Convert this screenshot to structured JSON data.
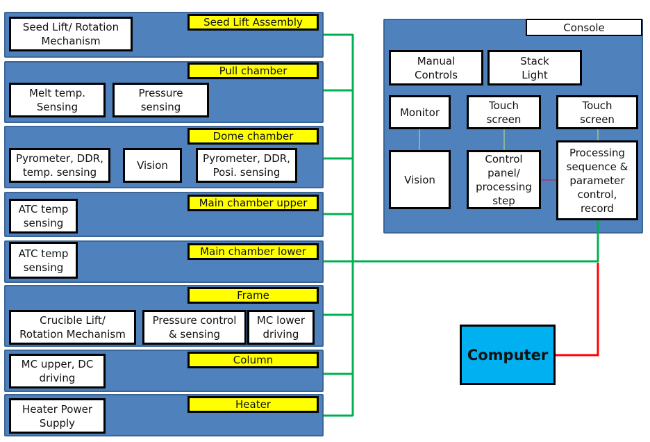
{
  "colors": {
    "panel": "#4F81BD",
    "label": "#FFFF00",
    "computer": "#00B0F0",
    "bus": "#00B050",
    "signal": "#FF0000",
    "thin_link": "#C4E86B"
  },
  "sections": [
    {
      "label": "Seed Lift Assembly",
      "boxes": [
        "Seed Lift/ Rotation\nMechanism"
      ]
    },
    {
      "label": "Pull chamber",
      "boxes": [
        "Melt temp.\nSensing",
        "Pressure\nsensing"
      ]
    },
    {
      "label": "Dome chamber",
      "boxes": [
        "Pyrometer, DDR,\ntemp. sensing",
        "Vision",
        "Pyrometer, DDR,\nPosi. sensing"
      ]
    },
    {
      "label": "Main chamber upper",
      "boxes": [
        "ATC temp\nsensing"
      ]
    },
    {
      "label": "Main chamber lower",
      "boxes": [
        "ATC temp\nsensing"
      ]
    },
    {
      "label": "Frame",
      "boxes": [
        "Crucible Lift/\nRotation Mechanism",
        "Pressure control\n& sensing",
        "MC lower\ndriving"
      ]
    },
    {
      "label": "Column",
      "boxes": [
        "MC upper, DC\ndriving"
      ]
    },
    {
      "label": "Heater",
      "boxes": [
        "Heater Power\nSupply"
      ]
    }
  ],
  "console": {
    "label": "Console",
    "boxes": [
      "Manual\nControls",
      "Stack\nLight",
      "Monitor",
      "Touch\nscreen",
      "Touch\nscreen",
      "Vision",
      "Control\npanel/\nprocessing\nstep",
      "Processing\nsequence &\nparameter\ncontrol,\nrecord"
    ]
  },
  "computer": {
    "label": "Computer"
  }
}
